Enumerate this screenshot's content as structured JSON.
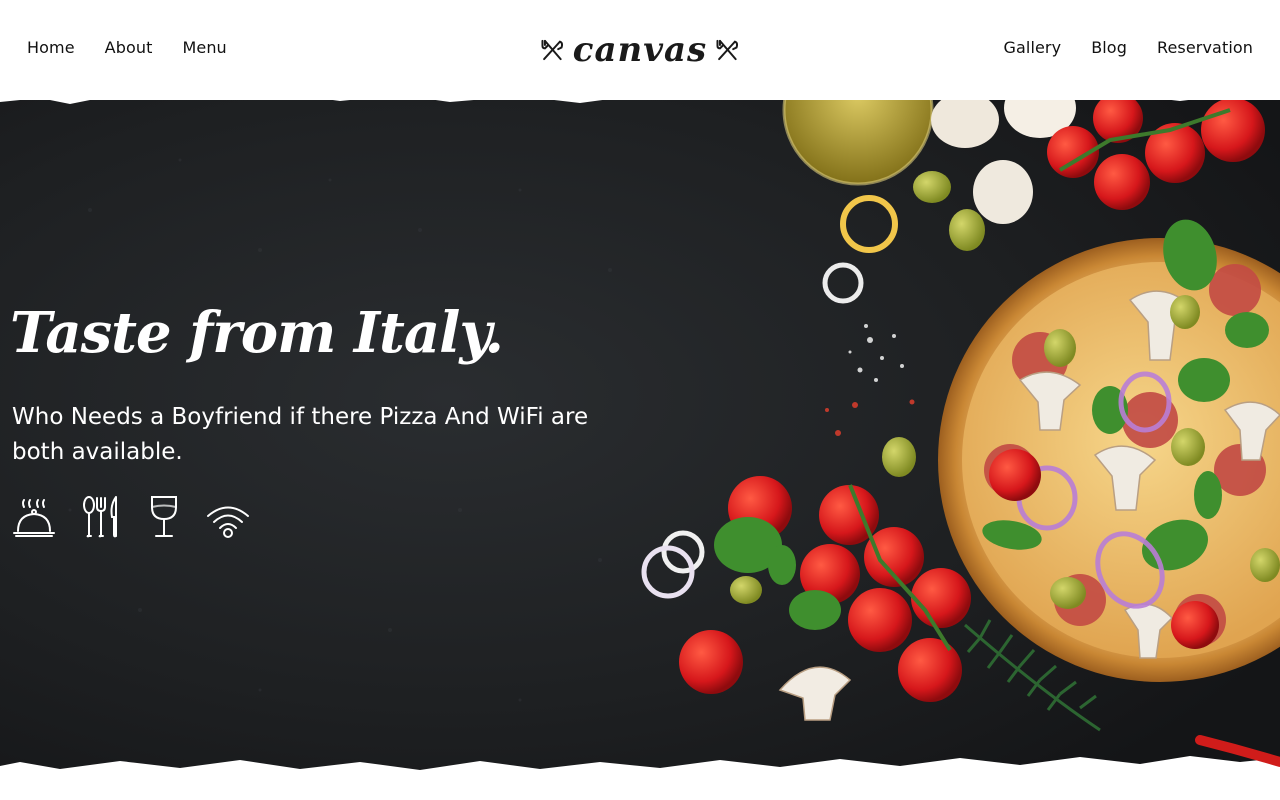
{
  "nav": {
    "left": [
      {
        "label": "Home"
      },
      {
        "label": "About"
      },
      {
        "label": "Menu"
      }
    ],
    "right": [
      {
        "label": "Gallery"
      },
      {
        "label": "Blog"
      },
      {
        "label": "Reservation"
      }
    ]
  },
  "brand": {
    "logo_text": "canvas",
    "logo_icon": "crossed-fork-knife-icon"
  },
  "hero": {
    "title": "Taste from Italy.",
    "subtitle": "Who Needs a Boyfriend if there Pizza And WiFi are both available.",
    "features": [
      {
        "icon": "cloche-icon"
      },
      {
        "icon": "cutlery-icon"
      },
      {
        "icon": "wine-glass-icon"
      },
      {
        "icon": "wifi-icon"
      }
    ]
  },
  "colors": {
    "background": "#ffffff",
    "hero_dark": "#1b1d1f",
    "text_light": "#ffffff",
    "text_dark": "#111111"
  }
}
